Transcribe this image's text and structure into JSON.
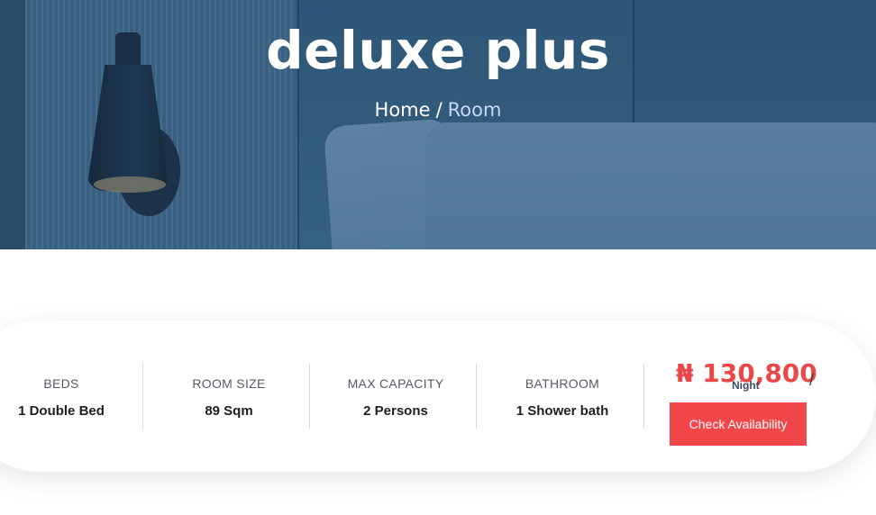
{
  "hero": {
    "title": "deluxe plus",
    "breadcrumb": {
      "home": "Home",
      "separator": "/",
      "current": "Room"
    }
  },
  "room_info": {
    "stats": [
      {
        "label": "BEDS",
        "value": "1 Double Bed"
      },
      {
        "label": "ROOM SIZE",
        "value": "89 Sqm"
      },
      {
        "label": "MAX CAPACITY",
        "value": "2 Persons"
      },
      {
        "label": "BATHROOM",
        "value": "1 Shower bath"
      }
    ],
    "price": "₦ 130,800",
    "price_slash": "/",
    "price_unit": "Night",
    "button_label": "Check Availability"
  },
  "colors": {
    "accent": "#f2474a",
    "price": "#ea4848",
    "hero_overlay": "#3a6388"
  }
}
